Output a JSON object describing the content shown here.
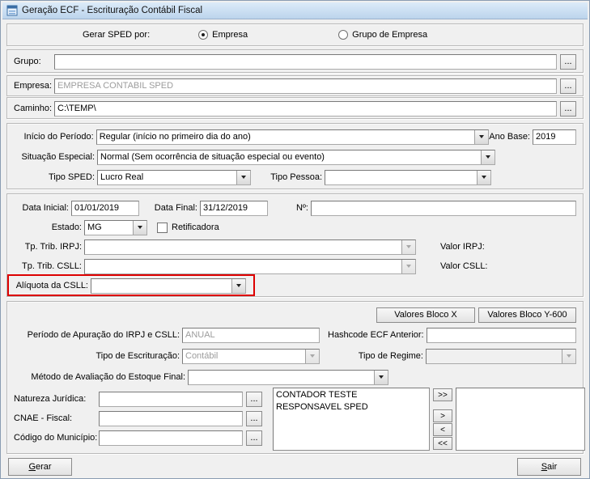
{
  "window": {
    "title": "Geração ECF - Escrituração Contábil Fiscal"
  },
  "gerar_sped_por": {
    "label": "Gerar SPED por:",
    "empresa": "Empresa",
    "grupo_de_empresa": "Grupo de Empresa"
  },
  "grupo": {
    "label": "Grupo:",
    "value": "",
    "browse": "..."
  },
  "empresa": {
    "label": "Empresa:",
    "value": "EMPRESA CONTABIL SPED",
    "browse": "..."
  },
  "caminho": {
    "label": "Caminho:",
    "value": "C:\\TEMP\\",
    "browse": "..."
  },
  "periodo": {
    "inicio_label": "Início do Período:",
    "inicio_value": "Regular (início no primeiro dia do ano)",
    "ano_base_label": "Ano Base:",
    "ano_base_value": "2019",
    "situacao_label": "Situação Especial:",
    "situacao_value": "Normal (Sem ocorrência de situação especial ou evento)",
    "tipo_sped_label": "Tipo SPED:",
    "tipo_sped_value": "Lucro Real",
    "tipo_pessoa_label": "Tipo Pessoa:",
    "tipo_pessoa_value": ""
  },
  "dados": {
    "data_inicial_label": "Data Inicial:",
    "data_inicial_value": "01/01/2019",
    "data_final_label": "Data Final:",
    "data_final_value": "31/12/2019",
    "numero_label": "Nº:",
    "numero_value": "",
    "estado_label": "Estado:",
    "estado_value": "MG",
    "retificadora_label": "Retificadora",
    "tp_trib_irpj_label": "Tp. Trib. IRPJ:",
    "tp_trib_irpj_value": "",
    "valor_irpj_label": "Valor IRPJ:",
    "tp_trib_csll_label": "Tp. Trib. CSLL:",
    "tp_trib_csll_value": "",
    "valor_csll_label": "Valor CSLL:",
    "aliquota_csll_label": "Alíquota da CSLL:",
    "aliquota_csll_value": ""
  },
  "detalhes": {
    "valores_bloco_x": "Valores Bloco X",
    "valores_bloco_y": "Valores Bloco Y-600",
    "periodo_apuracao_label": "Período de Apuração do IRPJ e CSLL:",
    "periodo_apuracao_value": "ANUAL",
    "hashcode_label": "Hashcode ECF Anterior:",
    "hashcode_value": "",
    "tipo_escrituracao_label": "Tipo de Escrituração:",
    "tipo_escrituracao_value": "Contábil",
    "tipo_regime_label": "Tipo de Regime:",
    "tipo_regime_value": "",
    "metodo_estoque_label": "Método de Avaliação do Estoque Final:",
    "metodo_estoque_value": "",
    "natureza_juridica_label": "Natureza Jurídica:",
    "natureza_juridica_value": "",
    "cnae_label": "CNAE - Fiscal:",
    "cnae_value": "",
    "municipio_label": "Código do Município:",
    "municipio_value": "",
    "browse": "...",
    "responsaveis": [
      "CONTADOR TESTE",
      "RESPONSAVEL SPED"
    ],
    "transfer_all_right": ">>",
    "transfer_one_right": ">",
    "transfer_one_left": "<",
    "transfer_all_left": "<<"
  },
  "footer": {
    "gerar": "Gerar",
    "sair": "Sair"
  }
}
